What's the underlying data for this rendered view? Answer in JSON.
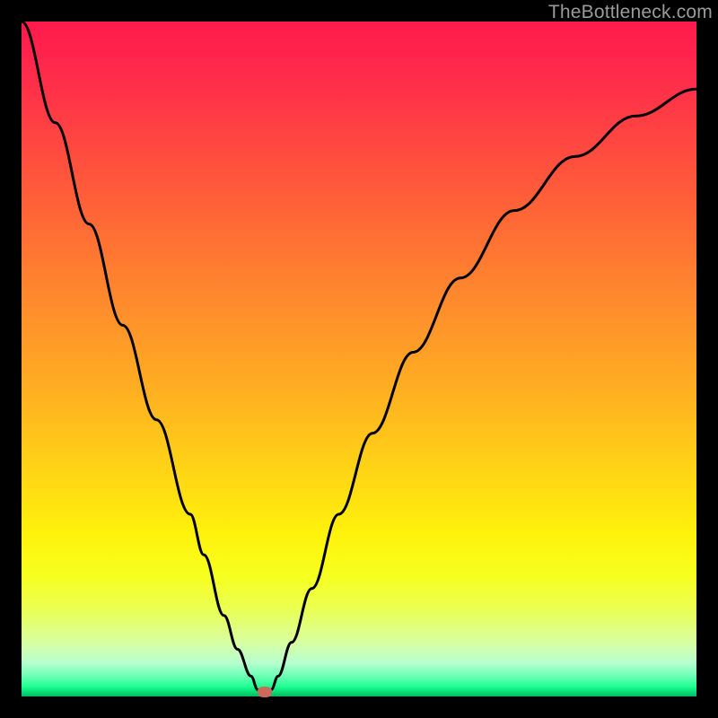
{
  "watermark": "TheBottleneck.com",
  "chart_data": {
    "type": "line",
    "title": "",
    "xlabel": "",
    "ylabel": "",
    "x_range": [
      0,
      100
    ],
    "y_range": [
      0,
      100
    ],
    "background_gradient": {
      "top_color": "#ff1a4d",
      "bottom_color": "#06b862",
      "meaning": "top=red(bad), bottom=green(good)"
    },
    "series": [
      {
        "name": "bottleneck-curve",
        "x": [
          0,
          5,
          10,
          15,
          20,
          25,
          27,
          30,
          32,
          34,
          35,
          36,
          37,
          38,
          40,
          43,
          47,
          52,
          58,
          65,
          73,
          82,
          91,
          100
        ],
        "y": [
          100,
          85,
          70,
          55,
          41,
          27,
          21,
          12,
          7,
          3,
          1,
          0,
          1,
          3,
          8,
          16,
          27,
          39,
          51,
          62,
          72,
          80,
          86,
          90
        ]
      }
    ],
    "marker": {
      "x": 36,
      "y": 0,
      "color": "#c96a5a"
    }
  }
}
